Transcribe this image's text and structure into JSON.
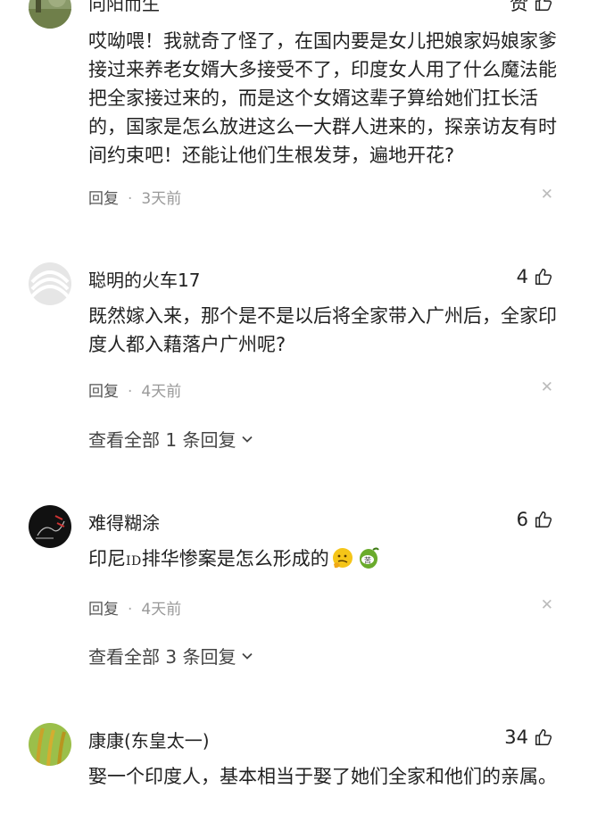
{
  "comments": [
    {
      "name": "向阳而生",
      "likes": "赞",
      "text": "哎呦喂！我就奇了怪了，在国内要是女儿把娘家妈娘家爹接过来养老女婿大多接受不了，印度女人用了什么魔法能把全家接过来的，而是这个女婿这辈子算给她们扛长活的，国家是怎么放进这么一大群人进来的，探亲访友有时间约束吧！还能让他们生根发芽，遍地开花?",
      "reply_label": "回复",
      "time": "3天前"
    },
    {
      "name": "聪明的火车17",
      "likes": "4",
      "text": "既然嫁入来，那个是不是以后将全家带入广州后，全家印度人都入藉落户广州呢?",
      "reply_label": "回复",
      "time": "4天前",
      "more_replies": "查看全部 1 条回复"
    },
    {
      "name": "难得糊涂",
      "likes": "6",
      "text_before": "印尼",
      "text_id": "ID",
      "text_after": "排华惨案是怎么形成的",
      "emoji_1": "thinking-face",
      "emoji_2": "bitter-melon-苦",
      "emoji_2_text": "苦",
      "reply_label": "回复",
      "time": "4天前",
      "more_replies": "查看全部 3 条回复"
    },
    {
      "name": "康康(东皇太一)",
      "likes": "34",
      "text": "娶一个印度人，基本相当于娶了她们全家和他们的亲属。"
    }
  ],
  "icons": {
    "like": "thumbs-up-icon",
    "close": "close-icon",
    "chevron": "chevron-down-icon"
  },
  "colors": {
    "text": "#222222",
    "meta": "#555555",
    "time": "#999999"
  }
}
